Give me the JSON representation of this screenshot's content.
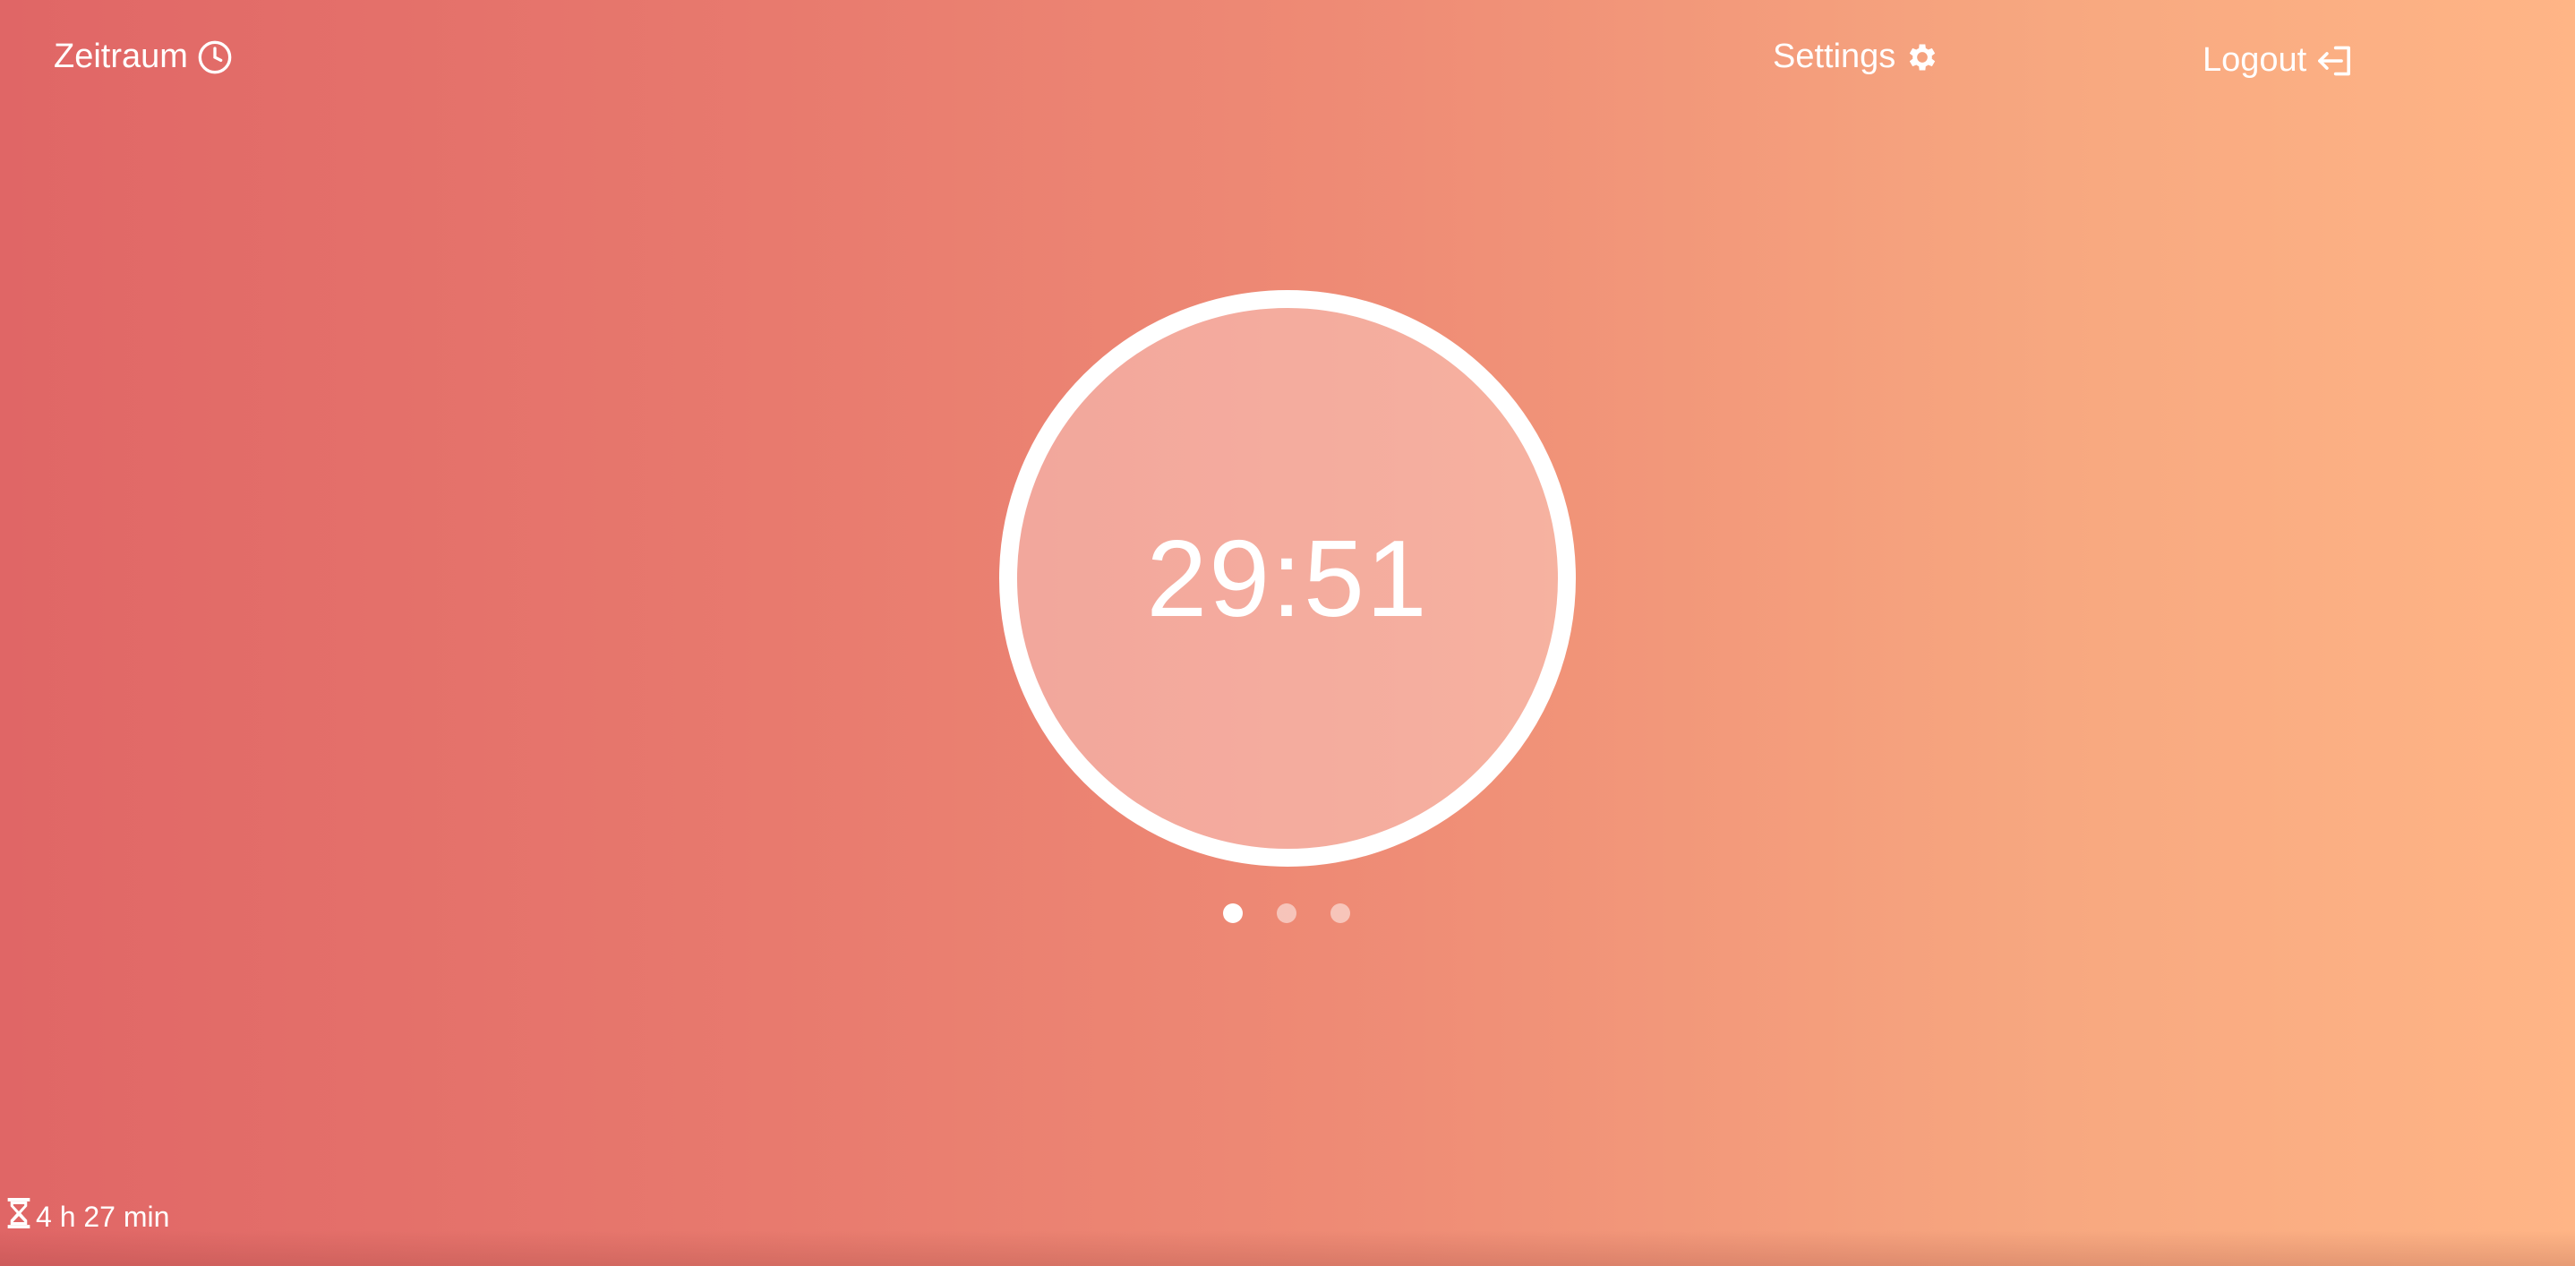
{
  "header": {
    "brand_label": "Zeitraum",
    "brand_icon": "clock-icon",
    "settings_label": "Settings",
    "settings_icon": "gear-icon",
    "logout_label": "Logout",
    "logout_icon": "logout-icon"
  },
  "timer": {
    "display": "29:51"
  },
  "pager": {
    "total": 3,
    "active_index": 0
  },
  "footer": {
    "worktime_icon": "hourglass-icon",
    "worktime_text": "4 h 27 min"
  },
  "colors": {
    "gradient_start": "#e06666",
    "gradient_end": "#ffb586",
    "text": "#ffffff"
  }
}
